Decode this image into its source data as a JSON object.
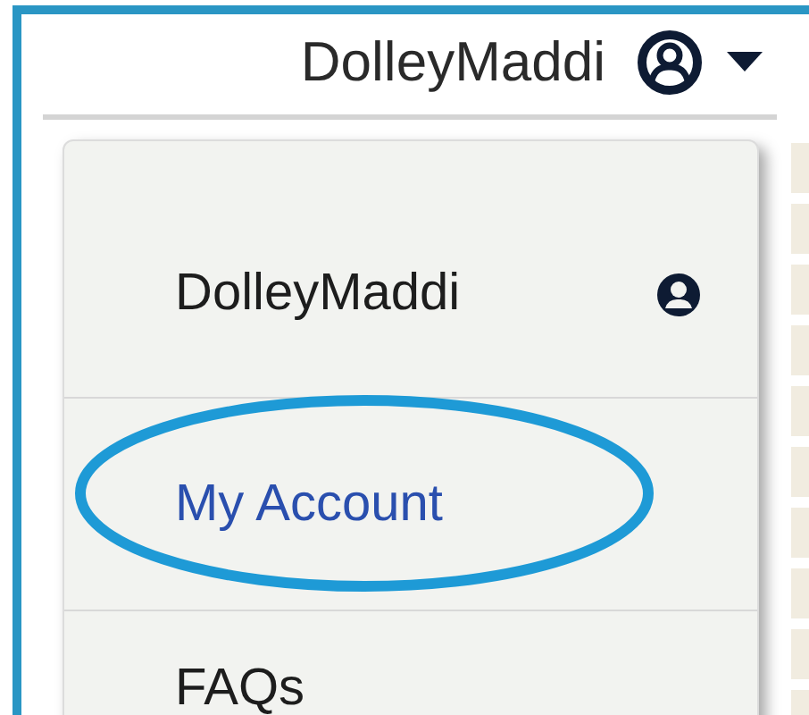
{
  "header": {
    "username": "DolleyMaddi",
    "menu_open": true
  },
  "menu": {
    "items": [
      {
        "kind": "user",
        "label": "DolleyMaddi",
        "selected": false
      },
      {
        "kind": "link",
        "label": "My Account",
        "selected": true
      },
      {
        "kind": "link",
        "label": "FAQs",
        "selected": false
      }
    ]
  }
}
